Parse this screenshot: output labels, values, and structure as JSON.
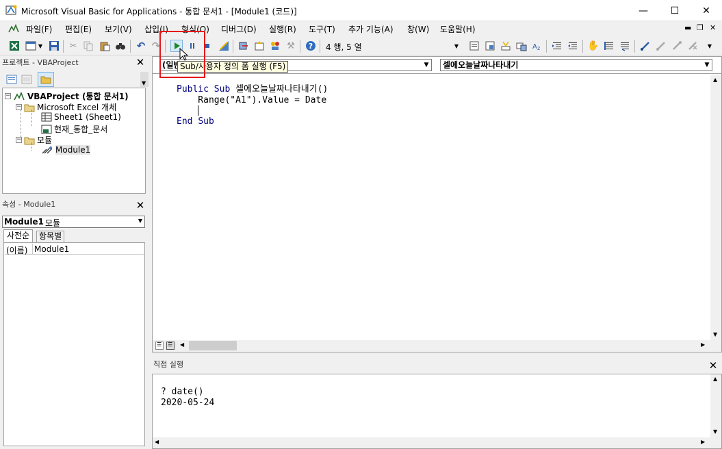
{
  "window": {
    "title": "Microsoft Visual Basic for Applications - 통합 문서1 - [Module1 (코드)]",
    "minimize": "—",
    "maximize": "☐",
    "close": "✕"
  },
  "menu": {
    "items": [
      "파일(F)",
      "편집(E)",
      "보기(V)",
      "삽입(I)",
      "형식(O)",
      "디버그(D)",
      "실행(R)",
      "도구(T)",
      "추가 기능(A)",
      "창(W)",
      "도움말(H)"
    ],
    "mdi_minimize": "▬",
    "mdi_restore": "❐",
    "mdi_close": "✕"
  },
  "toolbar": {
    "cursor_position": "4 행, 5 열",
    "tooltip": "Sub/사용자 정의 폼 실행 (F5)"
  },
  "project_panel": {
    "title": "프로젝트 - VBAProject",
    "tree": {
      "project": "VBAProject (통합 문서1)",
      "excel_objects": "Microsoft Excel 개체",
      "sheet1": "Sheet1 (Sheet1)",
      "this_workbook": "현재_통합_문서",
      "modules": "모듈",
      "module1": "Module1"
    }
  },
  "properties_panel": {
    "title": "속성 - Module1",
    "object_name": "Module1",
    "object_type": "모듈",
    "tab_alphabetic": "사전순",
    "tab_categorized": "항목별",
    "row_name": "(이름)",
    "row_value": "Module1"
  },
  "editor": {
    "object_combo": "(일반)",
    "procedure_combo": "셀에오늘날짜나타내기",
    "code": {
      "line1_kw1": "Public",
      "line1_kw2": "Sub",
      "line1_rest": " 셀에오늘날짜나타내기()",
      "line2": "    Range(\"A1\").Value = Date",
      "line4_kw1": "End",
      "line4_kw2": "Sub"
    }
  },
  "immediate": {
    "title": "직접 실행",
    "line1": "? date()",
    "line2": "2020-05-24"
  },
  "colors": {
    "keyword": "#00007f",
    "highlight": "#e4161a",
    "tooltip_bg": "#ffffe1"
  }
}
